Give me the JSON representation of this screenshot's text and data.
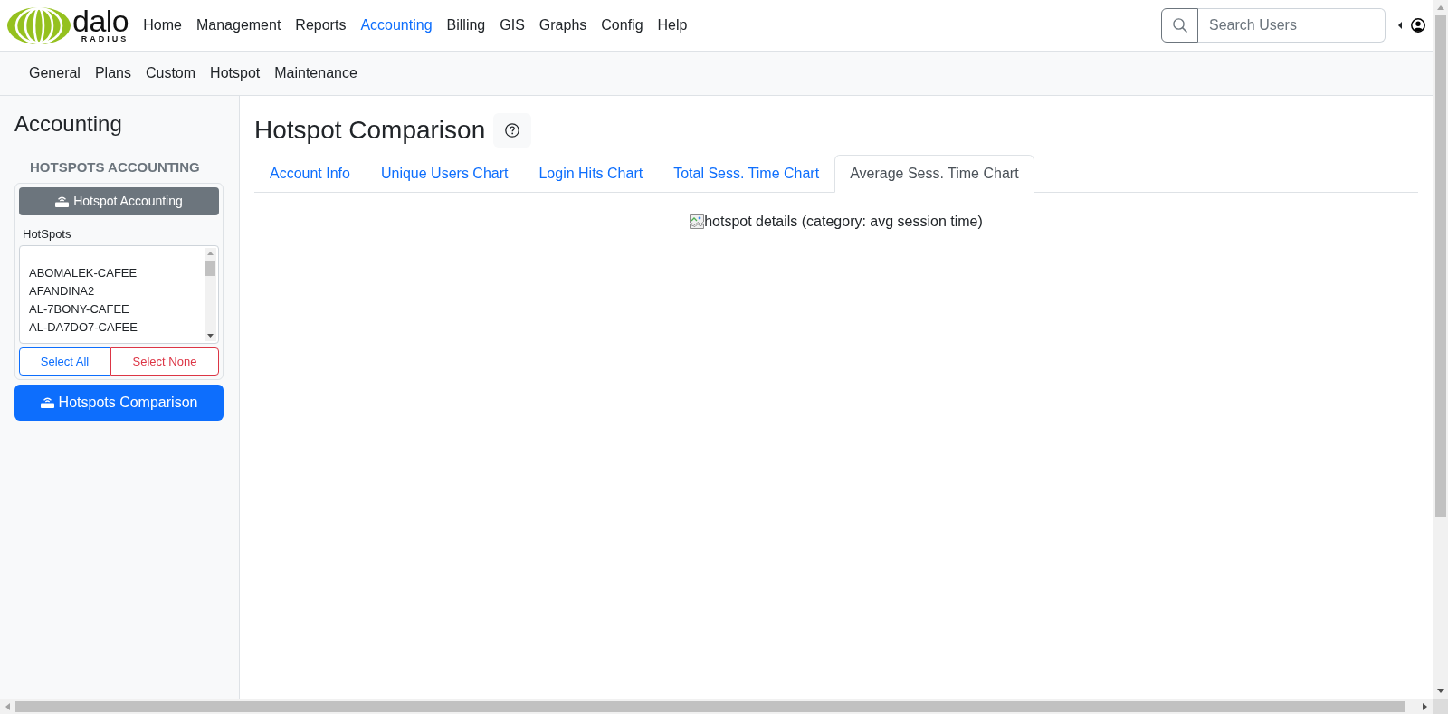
{
  "navbar": {
    "logo": {
      "text": "dalo",
      "subtext": "RADIUS"
    },
    "menu": [
      {
        "label": "Home",
        "selected": false
      },
      {
        "label": "Management",
        "selected": false
      },
      {
        "label": "Reports",
        "selected": false
      },
      {
        "label": "Accounting",
        "selected": true
      },
      {
        "label": "Billing",
        "selected": false
      },
      {
        "label": "GIS",
        "selected": false
      },
      {
        "label": "Graphs",
        "selected": false
      },
      {
        "label": "Config",
        "selected": false
      },
      {
        "label": "Help",
        "selected": false
      }
    ],
    "search": {
      "placeholder": "Search Users"
    }
  },
  "subnav": {
    "items": [
      "General",
      "Plans",
      "Custom",
      "Hotspot",
      "Maintenance"
    ]
  },
  "sidebar": {
    "title": "Accounting",
    "section_title": "HOTSPOTS ACCOUNTING",
    "accounting_button": "Hotspot Accounting",
    "hotspots": {
      "label": "HotSpots",
      "options": [
        {
          "label": "ABOMALEK-CAFEE",
          "selected": false
        },
        {
          "label": "AFANDINA2",
          "selected": false
        },
        {
          "label": "AL-7BONY-CAFEE",
          "selected": false
        },
        {
          "label": "AL-DA7DO7-CAFEE",
          "selected": false
        }
      ]
    },
    "select_all": "Select All",
    "select_none": "Select None",
    "comparison_button": "Hotspots Comparison"
  },
  "main": {
    "title": "Hotspot Comparison",
    "tabs": [
      {
        "label": "Account Info",
        "selected": false
      },
      {
        "label": "Unique Users Chart",
        "selected": false
      },
      {
        "label": "Login Hits Chart",
        "selected": false
      },
      {
        "label": "Total Sess. Time Chart",
        "selected": false
      },
      {
        "label": "Average Sess. Time Chart",
        "selected": true
      }
    ],
    "image": {
      "alt": "hotspot details (category: avg session time)"
    }
  }
}
